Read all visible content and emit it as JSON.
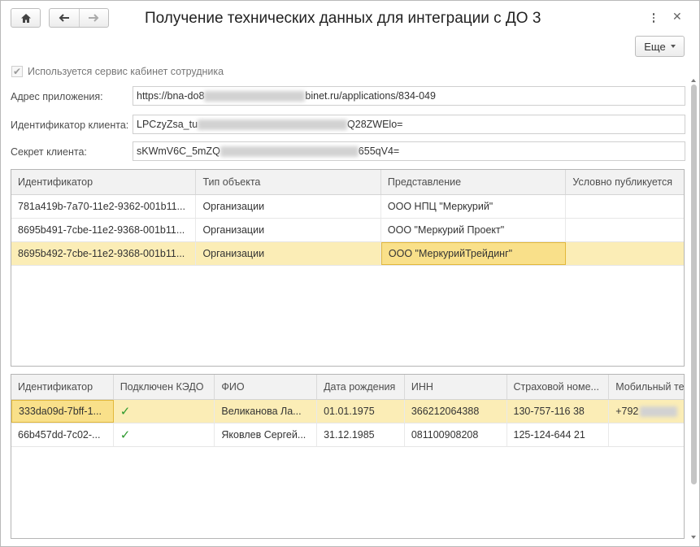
{
  "window": {
    "title": "Получение технических данных для интеграции с ДО 3",
    "more_label": "Еще"
  },
  "checkbox": {
    "label": "Используется сервис кабинет сотрудника",
    "checked": true
  },
  "fields": {
    "app_address": {
      "label": "Адрес приложения:",
      "value_start": "https://bna-do8",
      "value_end": "binet.ru/applications/834-049"
    },
    "client_id": {
      "label": "Идентификатор клиента:",
      "value_start": "LPCzyZsa_tu",
      "value_end": "Q28ZWElo="
    },
    "client_secret": {
      "label": "Секрет клиента:",
      "value_start": "sKWmV6C_5mZQ",
      "value_end": "655qV4="
    }
  },
  "objects_table": {
    "columns": [
      "Идентификатор",
      "Тип объекта",
      "Представление",
      "Условно публикуется"
    ],
    "rows": [
      {
        "id": "781a419b-7a70-11e2-9362-001b11...",
        "type": "Организации",
        "name": "ООО НПЦ \"Меркурий\"",
        "published": ""
      },
      {
        "id": "8695b491-7cbe-11e2-9368-001b11...",
        "type": "Организации",
        "name": "ООО \"Меркурий Проект\"",
        "published": ""
      },
      {
        "id": "8695b492-7cbe-11e2-9368-001b11...",
        "type": "Организации",
        "name": "ООО \"МеркурийТрейдинг\"",
        "published": ""
      }
    ]
  },
  "employees_table": {
    "columns": [
      "Идентификатор",
      "Подключен КЭДО",
      "ФИО",
      "Дата рождения",
      "ИНН",
      "Страховой номе...",
      "Мобильный те"
    ],
    "rows": [
      {
        "id": "333da09d-7bff-1...",
        "kedo": true,
        "fio": "Великанова Ла...",
        "birth": "01.01.1975",
        "inn": "366212064388",
        "snils": "130-757-116 38",
        "phone": "+792"
      },
      {
        "id": "66b457dd-7c02-...",
        "kedo": true,
        "fio": "Яковлев Сергей...",
        "birth": "31.12.1985",
        "inn": "081100908208",
        "snils": "125-124-644 21",
        "phone": ""
      }
    ]
  },
  "colors": {
    "selected_row": "#fbedb6",
    "current_cell": "#f9e08a",
    "check_green": "#2e9a2e"
  }
}
